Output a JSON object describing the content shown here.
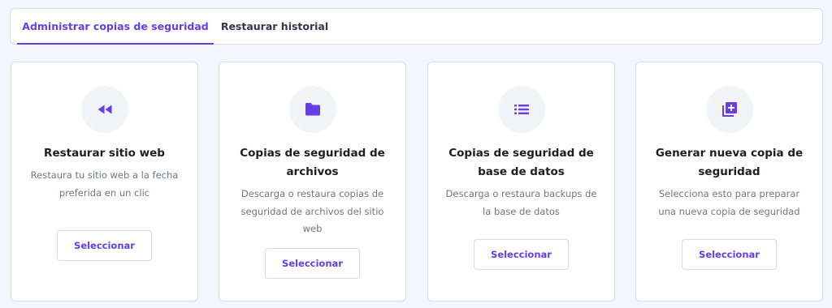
{
  "tabs": [
    {
      "label": "Administrar copias de seguridad",
      "active": true
    },
    {
      "label": "Restaurar historial",
      "active": false
    }
  ],
  "accent_color": "#673de6",
  "cards": [
    {
      "icon": "rewind-icon",
      "title": "Restaurar sitio web",
      "description": "Restaura tu sitio web a la fecha preferida en un clic",
      "button": "Seleccionar"
    },
    {
      "icon": "folder-icon",
      "title": "Copias de seguridad de archivos",
      "description": "Descarga o restaura copias de seguridad de archivos del sitio web",
      "button": "Seleccionar"
    },
    {
      "icon": "list-icon",
      "title": "Copias de seguridad de base de datos",
      "description": "Descarga o restaura backups de la base de datos",
      "button": "Seleccionar"
    },
    {
      "icon": "add-copy-icon",
      "title": "Generar nueva copia de seguridad",
      "description": "Selecciona esto para preparar una nueva copia de seguridad",
      "button": "Seleccionar"
    }
  ]
}
